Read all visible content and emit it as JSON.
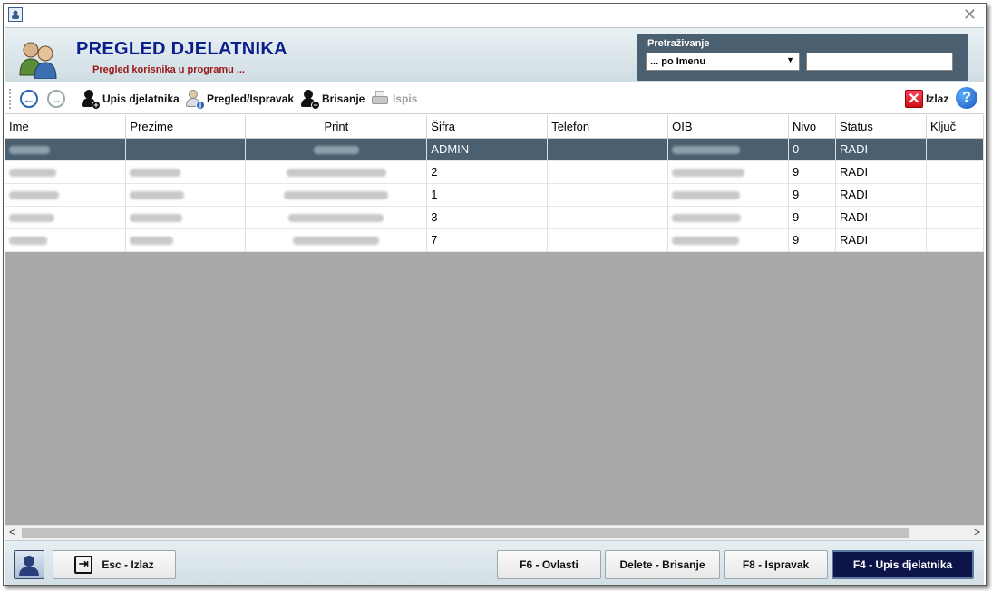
{
  "window": {
    "close_glyph": "✕"
  },
  "header": {
    "title": "PREGLED DJELATNIKA",
    "subtitle": "Pregled korisnika u programu ...",
    "search_label": "Pretraživanje",
    "search_mode": "... po Imenu",
    "search_value": ""
  },
  "toolbar": {
    "back_icon": "←",
    "forward_icon": "→",
    "add_label": "Upis djelatnika",
    "edit_label": "Pregled/Ispravak",
    "delete_label": "Brisanje",
    "print_label": "Ispis",
    "exit_label": "Izlaz",
    "exit_glyph": "✕",
    "help_glyph": "?"
  },
  "grid": {
    "columns": [
      "Ime",
      "Prezime",
      "Print",
      "Šifra",
      "Telefon",
      "OIB",
      "Nivo",
      "Status",
      "Ključ"
    ],
    "rows": [
      {
        "sifra": "ADMIN",
        "nivo": "0",
        "status": "RADI",
        "selected": true
      },
      {
        "sifra": "2",
        "nivo": "9",
        "status": "RADI",
        "selected": false
      },
      {
        "sifra": "1",
        "nivo": "9",
        "status": "RADI",
        "selected": false
      },
      {
        "sifra": "3",
        "nivo": "9",
        "status": "RADI",
        "selected": false
      },
      {
        "sifra": "7",
        "nivo": "9",
        "status": "RADI",
        "selected": false
      }
    ]
  },
  "scroll": {
    "left_arrow": "<",
    "right_arrow": ">"
  },
  "footer": {
    "esc_label": "Esc - Izlaz",
    "esc_glyph": "⇥",
    "f6_label": "F6 - Ovlasti",
    "delete_label": "Delete - Brisanje",
    "f8_label": "F8 - Ispravak",
    "f4_label": "F4 - Upis djelatnika"
  }
}
